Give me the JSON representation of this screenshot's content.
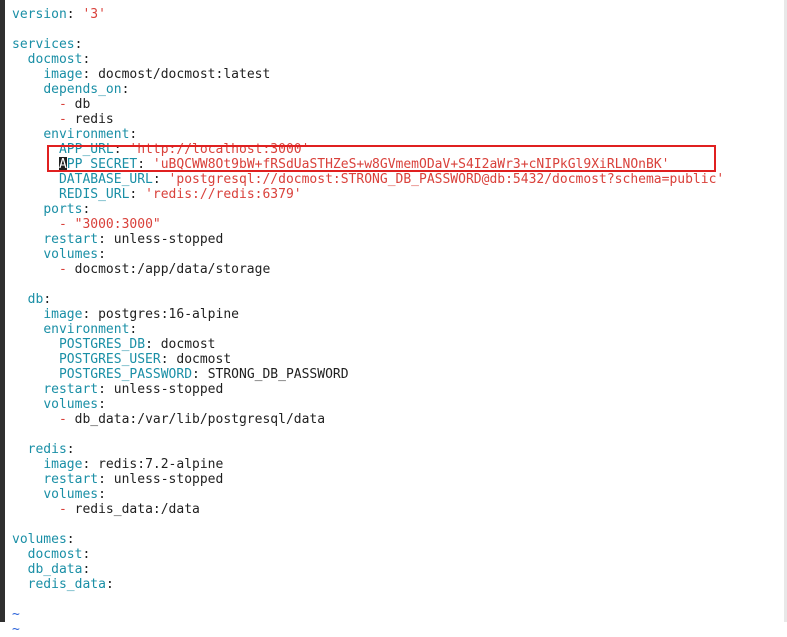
{
  "editor": {
    "lines": [
      {
        "key": "version",
        "colon": ": ",
        "value": "'3'",
        "vtype": "str"
      },
      {},
      {
        "key": "services",
        "colon": ":"
      },
      {
        "indent": "  ",
        "key": "docmost",
        "colon": ":"
      },
      {
        "indent": "    ",
        "key": "image",
        "colon": ": ",
        "value": "docmost/docmost:latest",
        "vtype": "plain"
      },
      {
        "indent": "    ",
        "key": "depends_on",
        "colon": ":"
      },
      {
        "indent": "      ",
        "dash": "- ",
        "value": "db",
        "vtype": "plain"
      },
      {
        "indent": "      ",
        "dash": "- ",
        "value": "redis",
        "vtype": "plain"
      },
      {
        "indent": "    ",
        "key": "environment",
        "colon": ":"
      },
      {
        "indent": "      ",
        "key": "APP_URL",
        "colon": ": ",
        "value": "'http://localhost:3000'",
        "vtype": "str"
      },
      {
        "indent": "      ",
        "cursor_char": "A",
        "key": "PP_SECRET",
        "colon": ": ",
        "value": "'uBQCWW8Ot9bW+fRSdUaSTHZeS+w8GVmemODaV+S4I2aWr3+cNIPkGl9XiRLNOnBK'",
        "vtype": "str"
      },
      {
        "indent": "      ",
        "key": "DATABASE_URL",
        "colon": ": ",
        "value": "'postgresql://docmost:STRONG_DB_PASSWORD@db:5432/docmost?schema=public'",
        "vtype": "str"
      },
      {
        "indent": "      ",
        "key": "REDIS_URL",
        "colon": ": ",
        "value": "'redis://redis:6379'",
        "vtype": "str"
      },
      {
        "indent": "    ",
        "key": "ports",
        "colon": ":"
      },
      {
        "indent": "      ",
        "dash": "- ",
        "value": "\"3000:3000\"",
        "vtype": "str"
      },
      {
        "indent": "    ",
        "key": "restart",
        "colon": ": ",
        "value": "unless-stopped",
        "vtype": "plain"
      },
      {
        "indent": "    ",
        "key": "volumes",
        "colon": ":"
      },
      {
        "indent": "      ",
        "dash": "- ",
        "value": "docmost:/app/data/storage",
        "vtype": "plain"
      },
      {},
      {
        "indent": "  ",
        "key": "db",
        "colon": ":"
      },
      {
        "indent": "    ",
        "key": "image",
        "colon": ": ",
        "value": "postgres:16-alpine",
        "vtype": "plain"
      },
      {
        "indent": "    ",
        "key": "environment",
        "colon": ":"
      },
      {
        "indent": "      ",
        "key": "POSTGRES_DB",
        "colon": ": ",
        "value": "docmost",
        "vtype": "plain"
      },
      {
        "indent": "      ",
        "key": "POSTGRES_USER",
        "colon": ": ",
        "value": "docmost",
        "vtype": "plain"
      },
      {
        "indent": "      ",
        "key": "POSTGRES_PASSWORD",
        "colon": ": ",
        "value": "STRONG_DB_PASSWORD",
        "vtype": "plain"
      },
      {
        "indent": "    ",
        "key": "restart",
        "colon": ": ",
        "value": "unless-stopped",
        "vtype": "plain"
      },
      {
        "indent": "    ",
        "key": "volumes",
        "colon": ":"
      },
      {
        "indent": "      ",
        "dash": "- ",
        "value": "db_data:/var/lib/postgresql/data",
        "vtype": "plain"
      },
      {},
      {
        "indent": "  ",
        "key": "redis",
        "colon": ":"
      },
      {
        "indent": "    ",
        "key": "image",
        "colon": ": ",
        "value": "redis:7.2-alpine",
        "vtype": "plain"
      },
      {
        "indent": "    ",
        "key": "restart",
        "colon": ": ",
        "value": "unless-stopped",
        "vtype": "plain"
      },
      {
        "indent": "    ",
        "key": "volumes",
        "colon": ":"
      },
      {
        "indent": "      ",
        "dash": "- ",
        "value": "redis_data:/data",
        "vtype": "plain"
      },
      {},
      {
        "key": "volumes",
        "colon": ":"
      },
      {
        "indent": "  ",
        "key": "docmost",
        "colon": ":"
      },
      {
        "indent": "  ",
        "key": "db_data",
        "colon": ":"
      },
      {
        "indent": "  ",
        "key": "redis_data",
        "colon": ":"
      },
      {},
      {
        "tilde": "~"
      },
      {
        "tilde": "~"
      }
    ]
  },
  "colors": {
    "key": "#1a8fa6",
    "string": "#d9413b",
    "tilde": "#2a62d9",
    "highlight_border": "#e02020"
  }
}
